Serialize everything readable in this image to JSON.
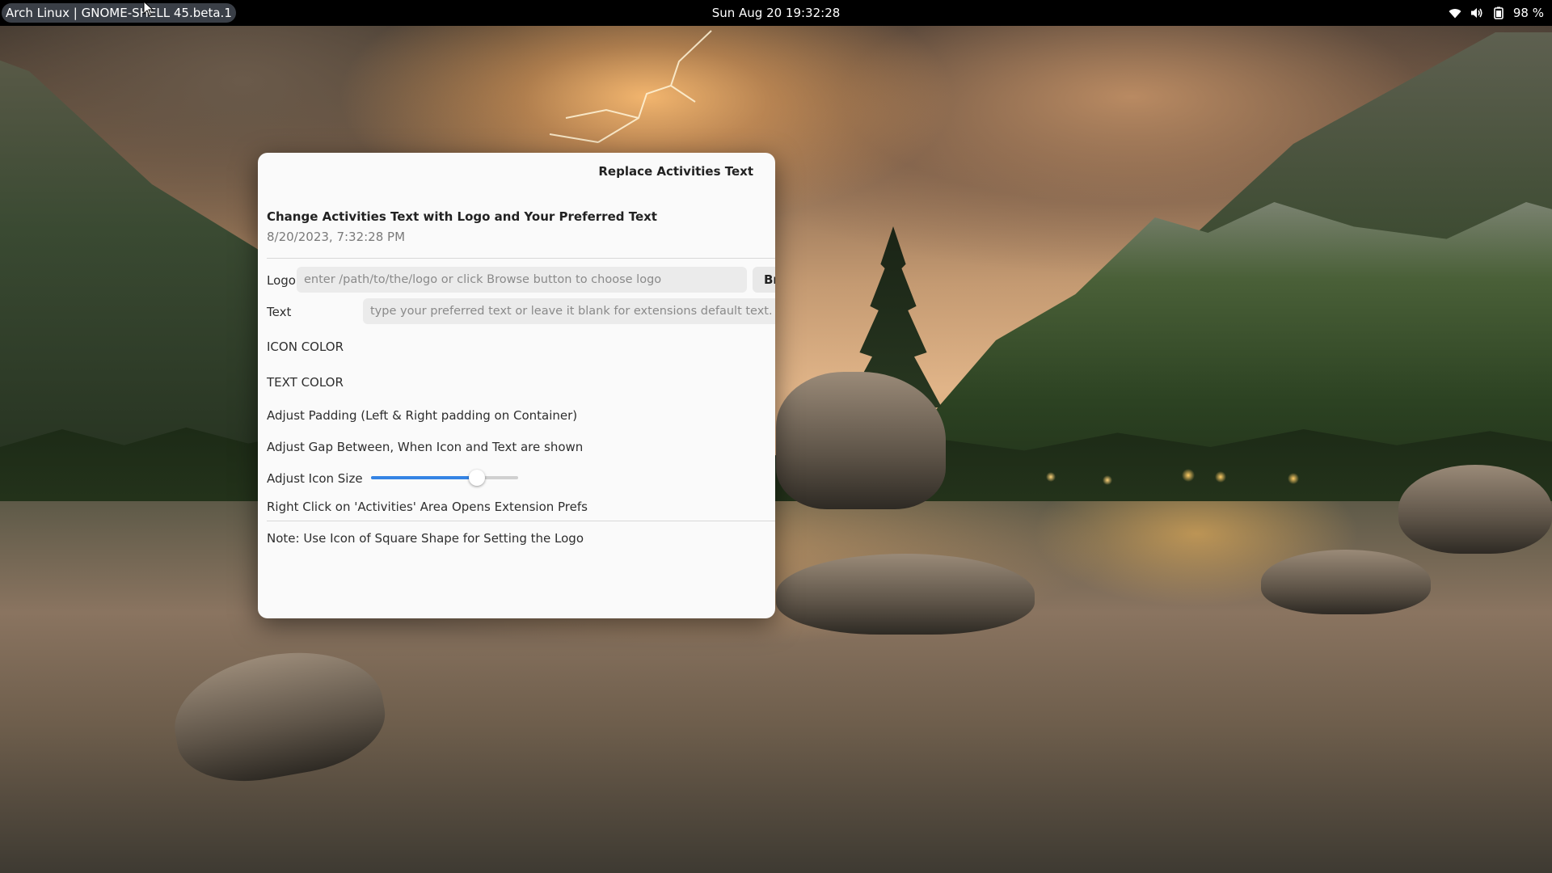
{
  "topbar": {
    "activities_label": "Arch Linux | GNOME-SHELL 45.beta.1",
    "clock": "Sun Aug 20  19:32:28",
    "battery": "98 %",
    "icons": [
      "wifi-icon",
      "volume-icon",
      "battery-icon"
    ]
  },
  "window": {
    "title": "Replace Activities Text",
    "header_title": "Change Activities Text with Logo and Your Preferred Text",
    "header_date": "8/20/2023, 7:32:28 PM",
    "logo": {
      "label": "Logo",
      "placeholder": "enter /path/to/the/logo or click Browse button to choose logo",
      "value": "",
      "browse_label": "Browse"
    },
    "text": {
      "label": "Text",
      "placeholder": "type your preferred text or leave it blank for extensions default text.",
      "value": ""
    },
    "icon_color_label": "ICON COLOR",
    "text_color_label": "TEXT COLOR",
    "padding_label": "Adjust Padding (Left & Right padding on Container)",
    "gap_label": "Adjust Gap Between, When Icon and Text are shown",
    "icon_size": {
      "label": "Adjust Icon Size",
      "fraction": 0.72
    },
    "right_click_label": "Right Click on 'Activities' Area Opens Extension Prefs",
    "note": "Note: Use Icon of Square Shape for Setting the Logo"
  },
  "colors": {
    "accent": "#3584e4",
    "topbar": "#000000",
    "window_bg": "#fafafa",
    "entry_bg": "#ebebeb"
  }
}
